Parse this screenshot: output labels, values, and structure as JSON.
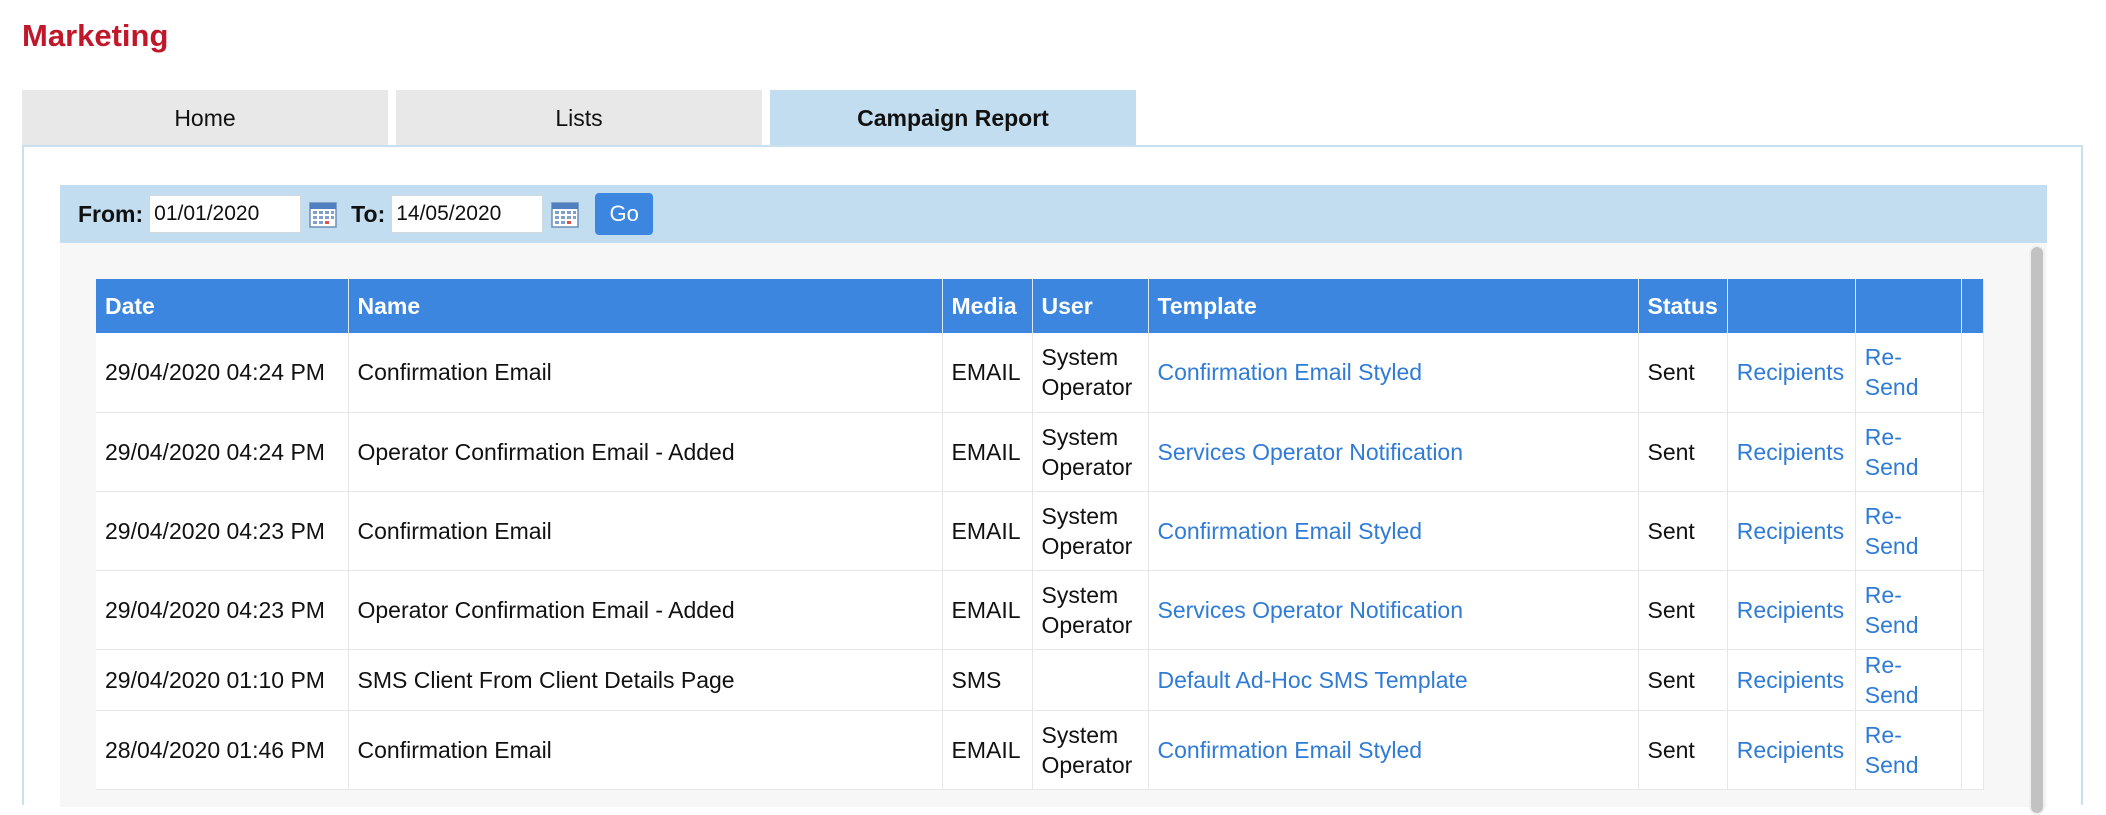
{
  "page": {
    "title": "Marketing"
  },
  "tabs": [
    {
      "label": "Home"
    },
    {
      "label": "Lists"
    },
    {
      "label": "Campaign Report"
    }
  ],
  "filter": {
    "from_label": "From:",
    "from_value": "01/01/2020",
    "to_label": "To:",
    "to_value": "14/05/2020",
    "go_label": "Go"
  },
  "table": {
    "columns": [
      "Date",
      "Name",
      "Media",
      "User",
      "Template",
      "Status",
      "",
      ""
    ],
    "rows": [
      {
        "date": "29/04/2020 04:24 PM",
        "name": "Confirmation Email",
        "media": "EMAIL",
        "user": "System Operator",
        "template": "Confirmation Email Styled",
        "status": "Sent",
        "recipients": "Recipients",
        "resend": "Re-Send"
      },
      {
        "date": "29/04/2020 04:24 PM",
        "name": "Operator Confirmation Email - Added",
        "media": "EMAIL",
        "user": "System Operator",
        "template": "Services Operator Notification",
        "status": "Sent",
        "recipients": "Recipients",
        "resend": "Re-Send"
      },
      {
        "date": "29/04/2020 04:23 PM",
        "name": "Confirmation Email",
        "media": "EMAIL",
        "user": "System Operator",
        "template": "Confirmation Email Styled",
        "status": "Sent",
        "recipients": "Recipients",
        "resend": "Re-Send"
      },
      {
        "date": "29/04/2020 04:23 PM",
        "name": "Operator Confirmation Email - Added",
        "media": "EMAIL",
        "user": "System Operator",
        "template": "Services Operator Notification",
        "status": "Sent",
        "recipients": "Recipients",
        "resend": "Re-Send"
      },
      {
        "date": "29/04/2020 01:10 PM",
        "name": "SMS Client From Client Details Page",
        "media": "SMS",
        "user": "",
        "template": "Default Ad-Hoc SMS Template",
        "status": "Sent",
        "recipients": "Recipients",
        "resend": "Re-Send"
      },
      {
        "date": "28/04/2020 01:46 PM",
        "name": "Confirmation Email",
        "media": "EMAIL",
        "user": "System Operator",
        "template": "Confirmation Email Styled",
        "status": "Sent",
        "recipients": "Recipients",
        "resend": "Re-Send"
      }
    ]
  },
  "icons": {
    "calendar": "calendar-icon"
  },
  "colors": {
    "title": "#c0182a",
    "header_bg": "#3c86e0",
    "filter_bg": "#c2ddf0",
    "link": "#2f7bd6"
  }
}
